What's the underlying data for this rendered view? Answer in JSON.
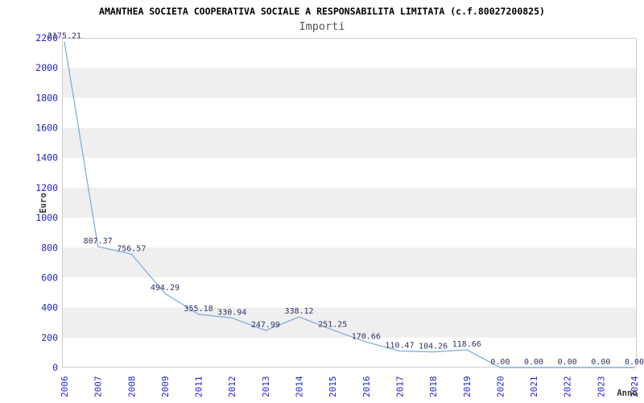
{
  "header": {
    "title": "AMANTHEA SOCIETA COOPERATIVA SOCIALE A RESPONSABILITA LIMITATA (c.f.80027200825)",
    "subtitle": "Importi"
  },
  "chart_data": {
    "type": "line",
    "title": "AMANTHEA SOCIETA COOPERATIVA SOCIALE A RESPONSABILITA LIMITATA (c.f.80027200825)",
    "subtitle": "Importi",
    "xlabel": "Anno",
    "ylabel": "Euro",
    "categories": [
      "2006",
      "2007",
      "2008",
      "2009",
      "2011",
      "2012",
      "2013",
      "2014",
      "2015",
      "2016",
      "2017",
      "2018",
      "2019",
      "2020",
      "2021",
      "2022",
      "2023",
      "2024"
    ],
    "values": [
      2175.21,
      807.37,
      756.57,
      494.29,
      355.18,
      330.94,
      247.99,
      338.12,
      251.25,
      170.66,
      110.47,
      104.26,
      118.66,
      0,
      0,
      0,
      0,
      0
    ],
    "value_labels": [
      "2175.21",
      "807.37",
      "756.57",
      "494.29",
      "355.18",
      "330.94",
      "247.99",
      "338.12",
      "251.25",
      "170.66",
      "110.47",
      "104.26",
      "118.66",
      "0.00",
      "0.00",
      "0.00",
      "0.00",
      "0.00"
    ],
    "yticks": [
      0,
      200,
      400,
      600,
      800,
      1000,
      1200,
      1400,
      1600,
      1800,
      2000,
      2200
    ],
    "ylim": [
      0,
      2200
    ],
    "ytick_interval": 200,
    "grid": "alternating-horizontal-bands",
    "legend": "none",
    "colors": {
      "line": "#7aa8e0",
      "tick_labels": "#2222cc",
      "value_labels": "#333366",
      "band": "#efefef",
      "plot_border": "#cccccc",
      "title": "#000000",
      "subtitle": "#555555",
      "axis_name": "#333333",
      "background": "#ffffff"
    }
  }
}
